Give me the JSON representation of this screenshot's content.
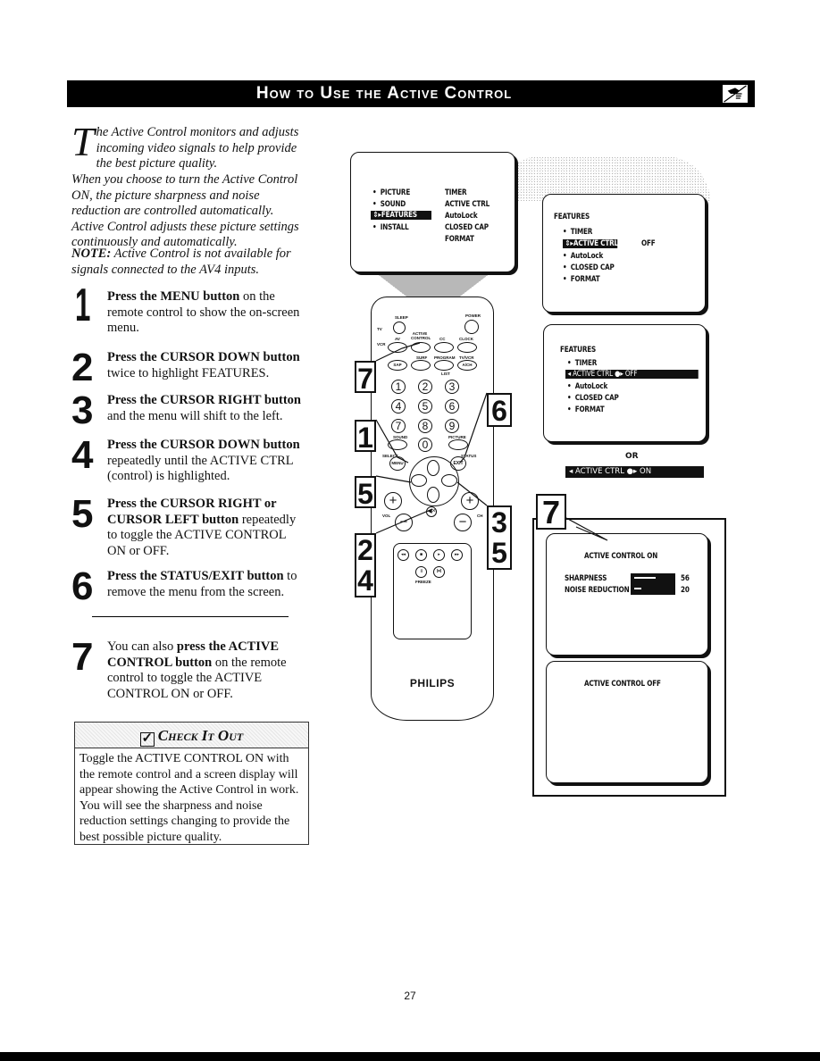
{
  "header": {
    "title": "How to Use  the Active Control",
    "icon": "hand-pointing-icon"
  },
  "intro": {
    "dropcap": "T",
    "p1_rest": "he Active Control monitors and adjusts incoming video signals to help provide the best picture quality.",
    "p2": "When you choose to turn the Active Control ON, the picture sharpness and noise reduction are controlled automatically. Active Control adjusts these picture settings continuously and automatically.",
    "note_label": "NOTE:",
    "note_text": " Active Control is not available for signals connected to the AV4 inputs."
  },
  "steps": [
    {
      "num": "1",
      "bold": "Press the MENU button",
      "rest": " on the remote control to show the on-screen menu."
    },
    {
      "num": "2",
      "bold": "Press the CURSOR DOWN button",
      "rest": " twice to highlight FEATURES."
    },
    {
      "num": "3",
      "bold": "Press the CURSOR RIGHT button",
      "rest": " and the menu will shift to the left."
    },
    {
      "num": "4",
      "bold": "Press the CURSOR DOWN button",
      "rest": " repeatedly until the ACTIVE CTRL (control) is highlighted."
    },
    {
      "num": "5",
      "bold": "Press the CURSOR RIGHT or CURSOR LEFT button",
      "rest": " repeatedly to toggle the ACTIVE CONTROL ON or OFF."
    },
    {
      "num": "6",
      "bold": "Press the STATUS/EXIT button",
      "rest": " to remove the menu from the screen."
    },
    {
      "num": "7",
      "pre": "You can also ",
      "bold": "press the ACTIVE CONTROL button",
      "rest": " on the remote control to toggle the ACTIVE CONTROL ON or OFF."
    }
  ],
  "check_it_out": {
    "title": "Check It Out",
    "check_glyph": "✓",
    "body": "Toggle the ACTIVE CONTROL ON with the remote control and a screen display will appear showing the Active Control in work. You will see the sharpness and noise reduction settings changing to provide the best possible picture quality."
  },
  "screen1": {
    "left_items": [
      "PICTURE",
      "SOUND",
      "FEATURES",
      "INSTALL"
    ],
    "highlighted": "FEATURES",
    "right_items": [
      "TIMER",
      "ACTIVE CTRL",
      "AutoLock",
      "CLOSED CAP",
      "FORMAT"
    ]
  },
  "screen2": {
    "title": "FEATURES",
    "items": [
      "TIMER",
      "ACTIVE CTRL",
      "AutoLock",
      "CLOSED CAP",
      "FORMAT"
    ],
    "highlighted": "ACTIVE CTRL",
    "value": "OFF"
  },
  "screen3": {
    "title": "FEATURES",
    "items": [
      "TIMER",
      "ACTIVE CTRL",
      "AutoLock",
      "CLOSED CAP",
      "FORMAT"
    ],
    "highlight_row": "◂ ACTIVE CTRL      ●▸ OFF"
  },
  "or_label": "OR",
  "on_bar": "◂ ACTIVE CTRL      ●▸ ON",
  "screen4": {
    "title": "ACTIVE CONTROL   ON",
    "sharpness_label": "SHARPNESS",
    "sharpness_value": "56",
    "noise_label": "NOISE REDUCTION",
    "noise_value": "20"
  },
  "screen5": {
    "title": "ACTIVE CONTROL   OFF"
  },
  "remote": {
    "brand": "PHILIPS",
    "labels": {
      "sleep": "SLEEP",
      "power": "POWER",
      "tv": "TV",
      "vcr": "VCR",
      "av": "AV",
      "active_control": "ACTIVE CONTROL",
      "cc": "CC",
      "clock": "CLOCK",
      "sap": "SAP",
      "surf": "SURF",
      "program_list": "PROGRAM",
      "list": "LIST",
      "tvvcr": "TV/VCR",
      "avi": "A/CH",
      "sound": "SOUND",
      "picture": "PICTURE",
      "select": "SELECT",
      "status": "STATUS",
      "menu": "MENU",
      "exit": "EXIT",
      "vol": "VOL",
      "ch": "CH",
      "freeze": "FREEZE"
    },
    "digits": [
      "1",
      "2",
      "3",
      "4",
      "5",
      "6",
      "7",
      "8",
      "9",
      "0"
    ],
    "transport": [
      "◂◂",
      "■",
      "▸",
      "▸▸"
    ],
    "callouts": [
      "7",
      "1",
      "6",
      "5",
      "2",
      "4",
      "3",
      "5"
    ]
  },
  "callout_screen7": "7",
  "page_number": "27"
}
